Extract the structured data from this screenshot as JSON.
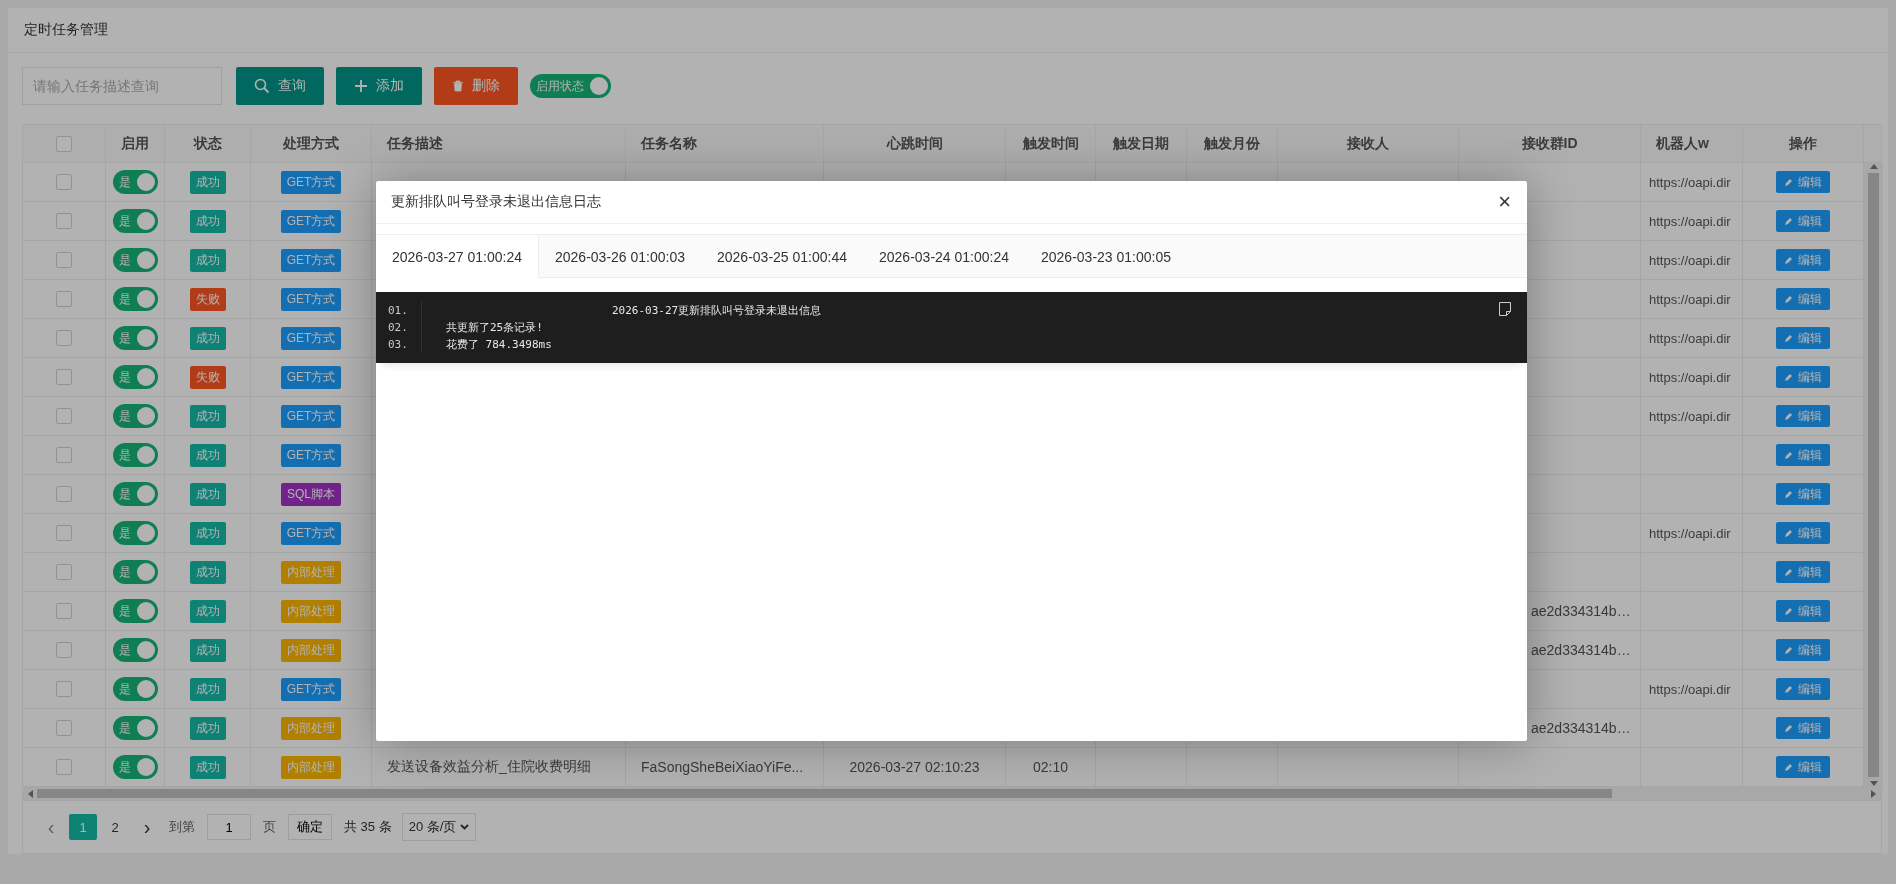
{
  "page": {
    "title": "定时任务管理"
  },
  "toolbar": {
    "search": {
      "placeholder": "请输入任务描述查询"
    },
    "buttons": [
      {
        "label": "查询",
        "kind": "search"
      },
      {
        "label": "添加",
        "kind": "add"
      },
      {
        "label": "删除",
        "kind": "delete"
      }
    ],
    "filter_switch": {
      "label": "启用状态",
      "on": true
    }
  },
  "table": {
    "header_checkbox": {
      "checked": false
    },
    "columns": [
      "启用",
      "状态",
      "处理方式",
      "任务描述",
      "任务名称",
      "心跳时间",
      "触发时间",
      "触发日期",
      "触发月份",
      "接收人",
      "接收群ID",
      "机器人w",
      "操作"
    ],
    "rows": [
      {
        "checked": false,
        "enabled": {
          "label": "是",
          "on": true
        },
        "status": {
          "label": "成功",
          "kind": "ok"
        },
        "method": {
          "label": "GET方式",
          "kind": "get"
        },
        "robot_url": "https://oapi.dir",
        "action": "编辑"
      },
      {
        "checked": false,
        "enabled": {
          "label": "是",
          "on": true
        },
        "status": {
          "label": "成功",
          "kind": "ok"
        },
        "method": {
          "label": "GET方式",
          "kind": "get"
        },
        "robot_url": "https://oapi.dir",
        "action": "编辑"
      },
      {
        "checked": false,
        "enabled": {
          "label": "是",
          "on": true
        },
        "status": {
          "label": "成功",
          "kind": "ok"
        },
        "method": {
          "label": "GET方式",
          "kind": "get"
        },
        "robot_url": "https://oapi.dir",
        "action": "编辑"
      },
      {
        "checked": false,
        "enabled": {
          "label": "是",
          "on": true
        },
        "status": {
          "label": "失败",
          "kind": "fail"
        },
        "method": {
          "label": "GET方式",
          "kind": "get"
        },
        "robot_url": "https://oapi.dir",
        "action": "编辑"
      },
      {
        "checked": false,
        "enabled": {
          "label": "是",
          "on": true
        },
        "status": {
          "label": "成功",
          "kind": "ok"
        },
        "method": {
          "label": "GET方式",
          "kind": "get"
        },
        "robot_url": "https://oapi.dir",
        "action": "编辑"
      },
      {
        "checked": false,
        "enabled": {
          "label": "是",
          "on": true
        },
        "status": {
          "label": "失败",
          "kind": "fail"
        },
        "method": {
          "label": "GET方式",
          "kind": "get"
        },
        "robot_url": "https://oapi.dir",
        "action": "编辑"
      },
      {
        "checked": false,
        "enabled": {
          "label": "是",
          "on": true
        },
        "status": {
          "label": "成功",
          "kind": "ok"
        },
        "method": {
          "label": "GET方式",
          "kind": "get"
        },
        "robot_url": "https://oapi.dir",
        "action": "编辑"
      },
      {
        "checked": false,
        "enabled": {
          "label": "是",
          "on": true
        },
        "status": {
          "label": "成功",
          "kind": "ok"
        },
        "method": {
          "label": "GET方式",
          "kind": "get"
        },
        "action": "编辑"
      },
      {
        "checked": false,
        "enabled": {
          "label": "是",
          "on": true
        },
        "status": {
          "label": "成功",
          "kind": "ok"
        },
        "method": {
          "label": "SQL脚本",
          "kind": "sql"
        },
        "action": "编辑"
      },
      {
        "checked": false,
        "enabled": {
          "label": "是",
          "on": true
        },
        "status": {
          "label": "成功",
          "kind": "ok"
        },
        "method": {
          "label": "GET方式",
          "kind": "get"
        },
        "robot_url": "https://oapi.dir",
        "action": "编辑"
      },
      {
        "checked": false,
        "enabled": {
          "label": "是",
          "on": true
        },
        "status": {
          "label": "成功",
          "kind": "ok"
        },
        "method": {
          "label": "内部处理",
          "kind": "internal"
        },
        "action": "编辑"
      },
      {
        "checked": false,
        "enabled": {
          "label": "是",
          "on": true
        },
        "status": {
          "label": "成功",
          "kind": "ok"
        },
        "method": {
          "label": "内部处理",
          "kind": "internal"
        },
        "group_id": "ae2d334314b…",
        "action": "编辑"
      },
      {
        "checked": false,
        "enabled": {
          "label": "是",
          "on": true
        },
        "status": {
          "label": "成功",
          "kind": "ok"
        },
        "method": {
          "label": "内部处理",
          "kind": "internal"
        },
        "group_id": "ae2d334314b…",
        "action": "编辑"
      },
      {
        "checked": false,
        "enabled": {
          "label": "是",
          "on": true
        },
        "status": {
          "label": "成功",
          "kind": "ok"
        },
        "method": {
          "label": "GET方式",
          "kind": "get"
        },
        "robot_url": "https://oapi.dir",
        "action": "编辑"
      },
      {
        "checked": false,
        "enabled": {
          "label": "是",
          "on": true
        },
        "status": {
          "label": "成功",
          "kind": "ok"
        },
        "method": {
          "label": "内部处理",
          "kind": "internal"
        },
        "group_id": "ae2d334314b…",
        "action": "编辑"
      },
      {
        "checked": false,
        "enabled": {
          "label": "是",
          "on": true
        },
        "status": {
          "label": "成功",
          "kind": "ok"
        },
        "method": {
          "label": "内部处理",
          "kind": "internal"
        },
        "description": "发送设备效益分析_住院收费明细",
        "name": "FaSongSheBeiXiaoYiFe...",
        "heartbeat": "2026-03-27 02:10:23",
        "trigger_time": "02:10",
        "action": "编辑"
      }
    ]
  },
  "pagination": {
    "prev": "‹",
    "pages": [
      {
        "label": "1",
        "selected": true
      },
      {
        "label": "2",
        "selected": false
      }
    ],
    "next": "›",
    "goto_label": "到第",
    "goto_value": "1",
    "page_unit": "页",
    "confirm": "确定",
    "total": "共 35 条",
    "page_size": "20 条/页"
  },
  "modal": {
    "title": "更新排队叫号登录未退出信息日志",
    "close": "×",
    "tabs": [
      {
        "label": "2026-03-27 01:00:24",
        "selected": true
      },
      {
        "label": "2026-03-26 01:00:03",
        "selected": false
      },
      {
        "label": "2026-03-25 01:00:44",
        "selected": false
      },
      {
        "label": "2026-03-24 01:00:24",
        "selected": false
      },
      {
        "label": "2026-03-23 01:00:05",
        "selected": false
      }
    ],
    "log_lines": [
      {
        "number": "01.",
        "text": "2026-03-27更新排队叫号登录未退出信息",
        "kind": "heading"
      },
      {
        "number": "02.",
        "text": "共更新了25条记录!",
        "kind": "text"
      },
      {
        "number": "03.",
        "text": "花费了 784.3498ms",
        "kind": "text"
      }
    ]
  }
}
